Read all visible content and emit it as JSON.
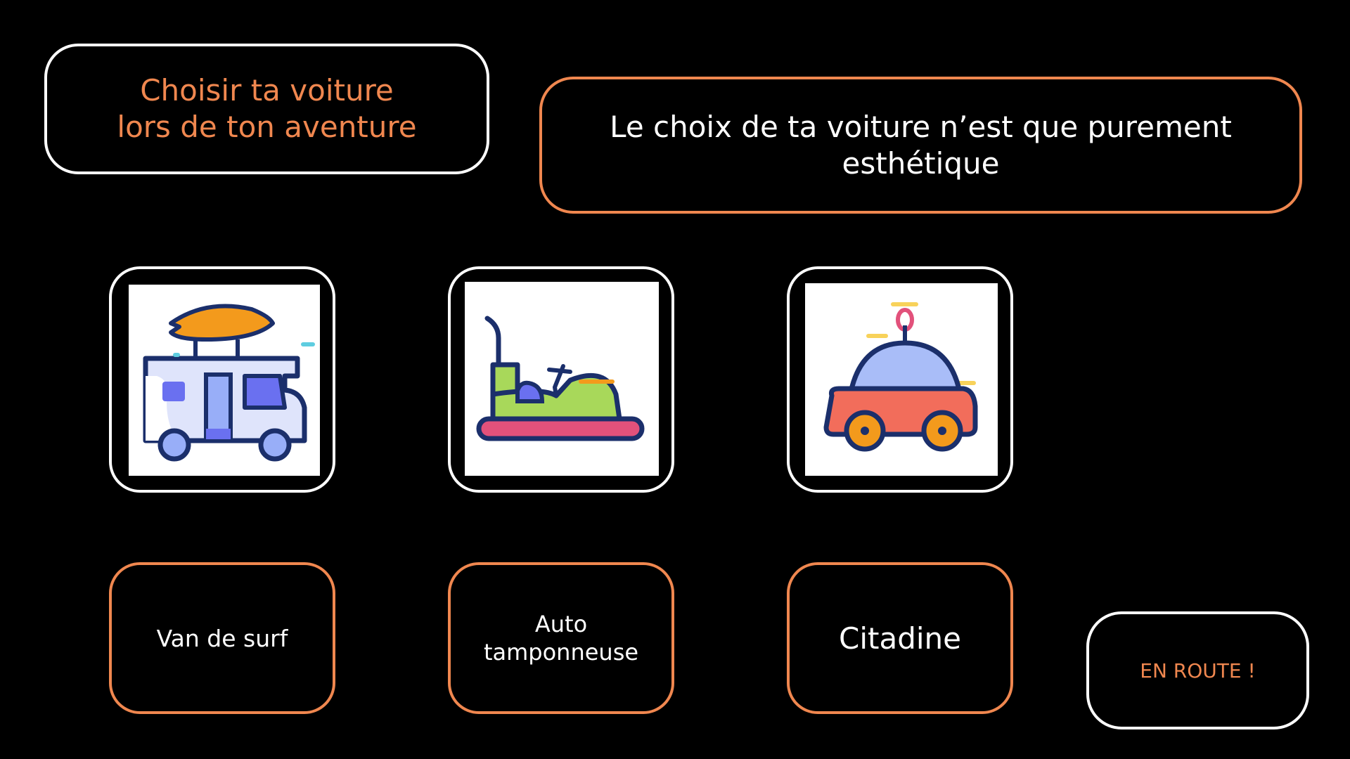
{
  "colors": {
    "background": "#000000",
    "accent": "#f0874f",
    "text": "#ffffff",
    "outline": "#1b2f6b"
  },
  "title": {
    "line1": "Choisir ta voiture",
    "line2": "lors de ton aventure"
  },
  "info": {
    "line1": "Le choix de ta voiture n’est que purement",
    "line2": "esthétique"
  },
  "options": [
    {
      "label": "Van de surf",
      "icon": "surf-van-icon"
    },
    {
      "label_line1": "Auto",
      "label_line2": "tamponneuse",
      "icon": "bumper-car-icon"
    },
    {
      "label": "Citadine",
      "icon": "city-car-icon"
    }
  ],
  "go_button": {
    "label": "EN ROUTE !"
  }
}
